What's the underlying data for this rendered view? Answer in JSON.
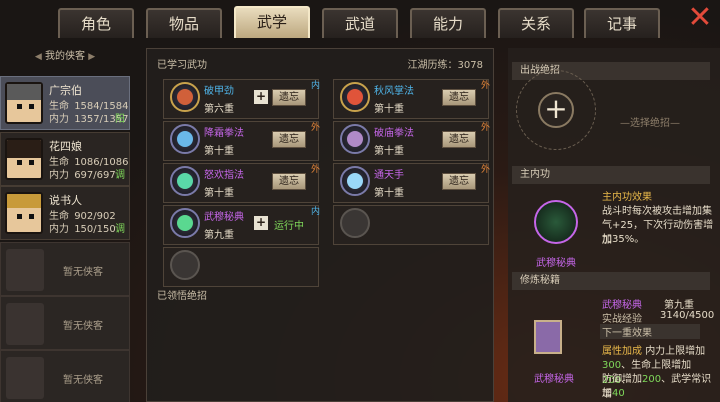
{
  "tabs": [
    "角色",
    "物品",
    "武学",
    "武道",
    "能力",
    "关系",
    "记事"
  ],
  "active_tab": "武学",
  "close_icon": "close-x-icon",
  "sidebar": {
    "header": "我的侠客",
    "heroes": [
      {
        "name": "广宗伯",
        "hp_label": "生命",
        "hp": "1584/1584",
        "mp_label": "内力",
        "mp": "1357/1357",
        "tag": "阳"
      },
      {
        "name": "花四娘",
        "hp_label": "生命",
        "hp": "1086/1086",
        "mp_label": "内力",
        "mp": "697/697",
        "tag": "调"
      },
      {
        "name": "说书人",
        "hp_label": "生命",
        "hp": "902/902",
        "mp_label": "内力",
        "mp": "150/150",
        "tag": "调"
      }
    ],
    "empty_slots": [
      "暂无侠客",
      "暂无侠客",
      "暂无侠客"
    ]
  },
  "middle": {
    "learned_title": "已学习武功",
    "exp_label": "江湖历练：3078",
    "forget_label": "遗忘",
    "running_label": "运行中",
    "comprehend_title": "已领悟绝招",
    "skills": [
      {
        "name": "破甲劲",
        "level": "第六重",
        "badge": "内",
        "color": "#4fb4e8",
        "action": "plus-forget"
      },
      {
        "name": "秋风掌法",
        "level": "第十重",
        "badge": "外",
        "color": "#4fb4e8",
        "action": "forget"
      },
      {
        "name": "降霜拳法",
        "level": "第十重",
        "badge": "外",
        "color": "#c566e8",
        "action": "forget"
      },
      {
        "name": "破庙拳法",
        "level": "第十重",
        "badge": "外",
        "color": "#c566e8",
        "action": "forget"
      },
      {
        "name": "怒欢指法",
        "level": "第十重",
        "badge": "外",
        "color": "#c566e8",
        "action": "forget"
      },
      {
        "name": "通天手",
        "level": "第十重",
        "badge": "外",
        "color": "#c566e8",
        "action": "forget"
      },
      {
        "name": "武穆秘典",
        "level": "第九重",
        "badge": "内",
        "color": "#c566e8",
        "action": "plus-run"
      }
    ]
  },
  "right": {
    "ultimate_title": "出战绝招",
    "select_hint": "—选择绝招—",
    "main_inner_title": "主内功",
    "effect_title": "主内功效果",
    "effect_text_1": "战斗时每次被攻击增加集",
    "effect_text_2": "气+25，下次行动伤害增加",
    "effect_text_3": "加35%。",
    "main_inner_name": "武穆秘典",
    "cultivate_title": "修炼秘籍",
    "book_name": "武穆秘典",
    "book_level": "第九重",
    "exp_label": "实战经验",
    "exp_value": "3140/4500",
    "next_label": "下一重效果",
    "bonus_label": "属性加成",
    "bonus_1a": "内力上限增加",
    "bonus_1b": "300",
    "bonus_1c": "、生命上限增加",
    "bonus_1d": "200",
    "bonus_1e": "、",
    "bonus_2a": "防御增加",
    "bonus_2b": "200",
    "bonus_2c": "、武学常识增",
    "bonus_3a": "加",
    "bonus_3b": "40",
    "book_caption": "武穆秘典"
  }
}
